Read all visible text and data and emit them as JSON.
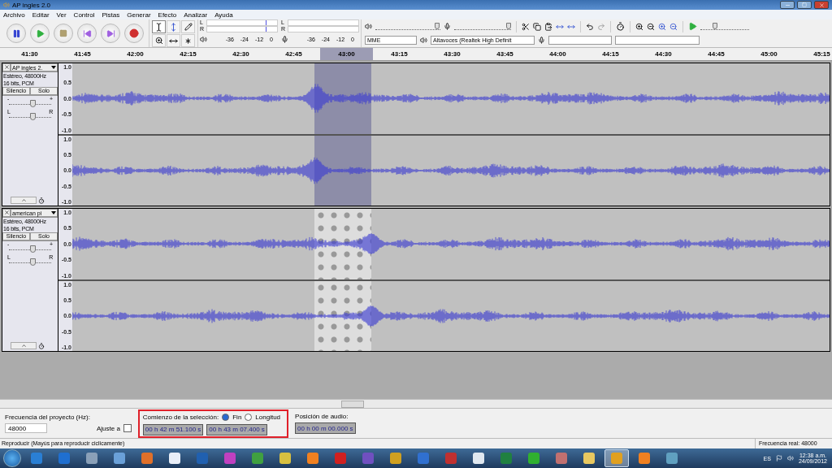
{
  "window": {
    "title": "AP ingles 2.0"
  },
  "menu": [
    "Archivo",
    "Editar",
    "Ver",
    "Control",
    "Pistas",
    "Generar",
    "Efecto",
    "Analizar",
    "Ayuda"
  ],
  "meters": [
    {
      "kind": "playback",
      "channels": [
        "L",
        "R"
      ],
      "ticks": [
        "-36",
        "-24",
        "-12",
        "0"
      ],
      "level": 0.84
    },
    {
      "kind": "record",
      "channels": [
        "L",
        "R"
      ],
      "ticks": [
        "-36",
        "-24",
        "-12",
        "0"
      ]
    }
  ],
  "mixer": {
    "output": {
      "level": 0.95
    },
    "input": {
      "level": 0.95
    }
  },
  "devices": {
    "host": "MME",
    "output": "Altavoces (Realtek High Definit"
  },
  "play_speed": {
    "level": 0.3
  },
  "ruler": [
    {
      "label": "41:30",
      "selected": false
    },
    {
      "label": "41:45",
      "selected": false
    },
    {
      "label": "42:00",
      "selected": false
    },
    {
      "label": "42:15",
      "selected": false
    },
    {
      "label": "42:30",
      "selected": false
    },
    {
      "label": "42:45",
      "selected": false
    },
    {
      "label": "43:00",
      "selected": true
    },
    {
      "label": "43:15",
      "selected": false
    },
    {
      "label": "43:30",
      "selected": false
    },
    {
      "label": "43:45",
      "selected": false
    },
    {
      "label": "44:00",
      "selected": false
    },
    {
      "label": "44:15",
      "selected": false
    },
    {
      "label": "44:30",
      "selected": false
    },
    {
      "label": "44:45",
      "selected": false
    },
    {
      "label": "45:00",
      "selected": false
    },
    {
      "label": "45:15",
      "selected": false
    }
  ],
  "tracks": [
    {
      "name": "AP ingles 2.",
      "info": "Estéreo, 48000Hz",
      "format": "16 bits, PCM",
      "mute": "Silencio",
      "solo": "Solo",
      "gain": {
        "minus": "-",
        "plus": "+",
        "level": 0.55
      },
      "pan": {
        "left": "L",
        "right": "R",
        "level": 0.55
      },
      "selected": true,
      "channels": [
        {
          "scale": [
            "1.0",
            "0.5",
            "0.0",
            "-0.5",
            "-1.0"
          ]
        },
        {
          "scale": [
            "1.0",
            "0.5",
            "0.0",
            "-0.5",
            "-1.0"
          ]
        }
      ]
    },
    {
      "name": "american pi",
      "info": "Estéreo, 48000Hz",
      "format": "16 bits, PCM",
      "mute": "Silencio",
      "solo": "Solo",
      "gain": {
        "minus": "-",
        "plus": "+",
        "level": 0.55
      },
      "pan": {
        "left": "L",
        "right": "R",
        "level": 0.55
      },
      "selected": false,
      "channels": [
        {
          "scale": [
            "1.0",
            "0.5",
            "0.0",
            "-0.5",
            "-1.0"
          ]
        },
        {
          "scale": [
            "1.0",
            "0.5",
            "0.0",
            "-0.5",
            "-1.0"
          ]
        }
      ]
    }
  ],
  "selection_bar": {
    "rate_label": "Frecuencia del proyecto (Hz):",
    "rate": "48000",
    "snap_label": "Ajuste a",
    "snap_checked": false,
    "start_label": "Comienzo de la selección:",
    "options": [
      {
        "label": "Fin",
        "selected": true
      },
      {
        "label": "Longitud",
        "selected": false
      }
    ],
    "start": "00 h 42 m 51.100 s",
    "end": "00 h 43 m 07.400 s",
    "position_label": "Posición de audio:",
    "position": "00 h 00 m 00.000 s"
  },
  "status": {
    "left": "Reproducir (Mayús para reproducir ciclicamente)",
    "right": "Frecuencia real: 48000"
  },
  "taskbar": {
    "apps": [
      {
        "color": "#2a7fd4",
        "selected": false
      },
      {
        "color": "#1f6fd0",
        "selected": false
      },
      {
        "color": "#8aa0b8",
        "selected": false
      },
      {
        "color": "#6aa0d8",
        "selected": false
      },
      {
        "color": "#e0702a",
        "selected": false
      },
      {
        "color": "#e8eef8",
        "selected": false
      },
      {
        "color": "#2060b0",
        "selected": false
      },
      {
        "color": "#c040c0",
        "selected": false
      },
      {
        "color": "#40a040",
        "selected": false
      },
      {
        "color": "#d8c040",
        "selected": false
      },
      {
        "color": "#f08020",
        "selected": false
      },
      {
        "color": "#d02020",
        "selected": false
      },
      {
        "color": "#7050c0",
        "selected": false
      },
      {
        "color": "#d0a020",
        "selected": false
      },
      {
        "color": "#3070d0",
        "selected": false
      },
      {
        "color": "#c03030",
        "selected": false
      },
      {
        "color": "#e0e8f0",
        "selected": false
      },
      {
        "color": "#208040",
        "selected": false
      },
      {
        "color": "#30b030",
        "selected": false
      },
      {
        "color": "#c07070",
        "selected": false
      },
      {
        "color": "#e8c860",
        "selected": false
      },
      {
        "color": "#e0a020",
        "selected": true
      },
      {
        "color": "#f08020",
        "selected": false
      },
      {
        "color": "#60a0c0",
        "selected": false
      }
    ],
    "language": "ES",
    "time": "12:38 a.m.",
    "date": "24/09/2012"
  }
}
